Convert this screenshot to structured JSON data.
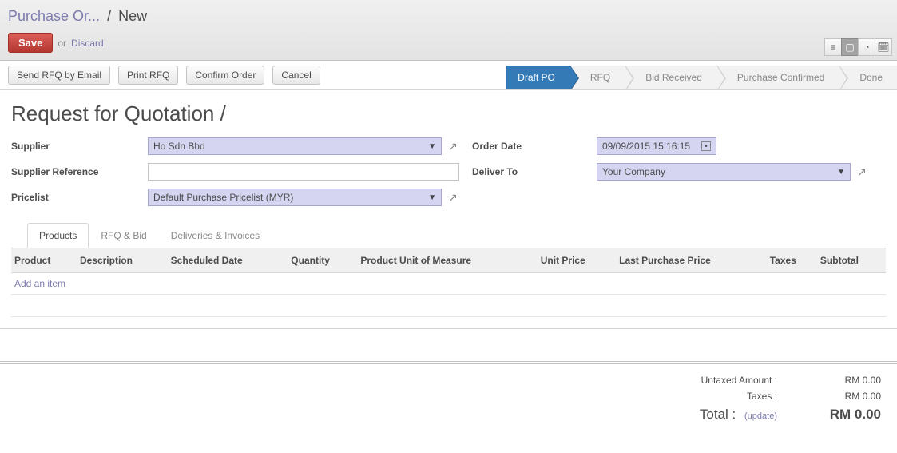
{
  "breadcrumb": {
    "parent": "Purchase Or...",
    "current": "New"
  },
  "topbar": {
    "save_label": "Save",
    "or_text": "or",
    "discard_label": "Discard"
  },
  "actions": {
    "send_rfq": "Send RFQ by Email",
    "print_rfq": "Print RFQ",
    "confirm_order": "Confirm Order",
    "cancel": "Cancel"
  },
  "status_steps": [
    "Draft PO",
    "RFQ",
    "Bid Received",
    "Purchase Confirmed",
    "Done"
  ],
  "status_active_index": 0,
  "page_title": "Request for Quotation /",
  "form": {
    "supplier_label": "Supplier",
    "supplier_value": "Ho Sdn Bhd",
    "supplier_ref_label": "Supplier Reference",
    "supplier_ref_value": "",
    "pricelist_label": "Pricelist",
    "pricelist_value": "Default Purchase Pricelist (MYR)",
    "order_date_label": "Order Date",
    "order_date_value": "09/09/2015 15:16:15",
    "deliver_to_label": "Deliver To",
    "deliver_to_value": "Your Company"
  },
  "tabs": [
    "Products",
    "RFQ & Bid",
    "Deliveries & Invoices"
  ],
  "tabs_active_index": 0,
  "table_headers": [
    "Product",
    "Description",
    "Scheduled Date",
    "Quantity",
    "Product Unit of Measure",
    "Unit Price",
    "Last Purchase Price",
    "Taxes",
    "Subtotal"
  ],
  "add_item_label": "Add an item",
  "totals": {
    "untaxed_label": "Untaxed Amount :",
    "untaxed_value": "RM 0.00",
    "taxes_label": "Taxes :",
    "taxes_value": "RM 0.00",
    "total_label": "Total :",
    "update_label": "(update)",
    "total_value": "RM 0.00"
  }
}
